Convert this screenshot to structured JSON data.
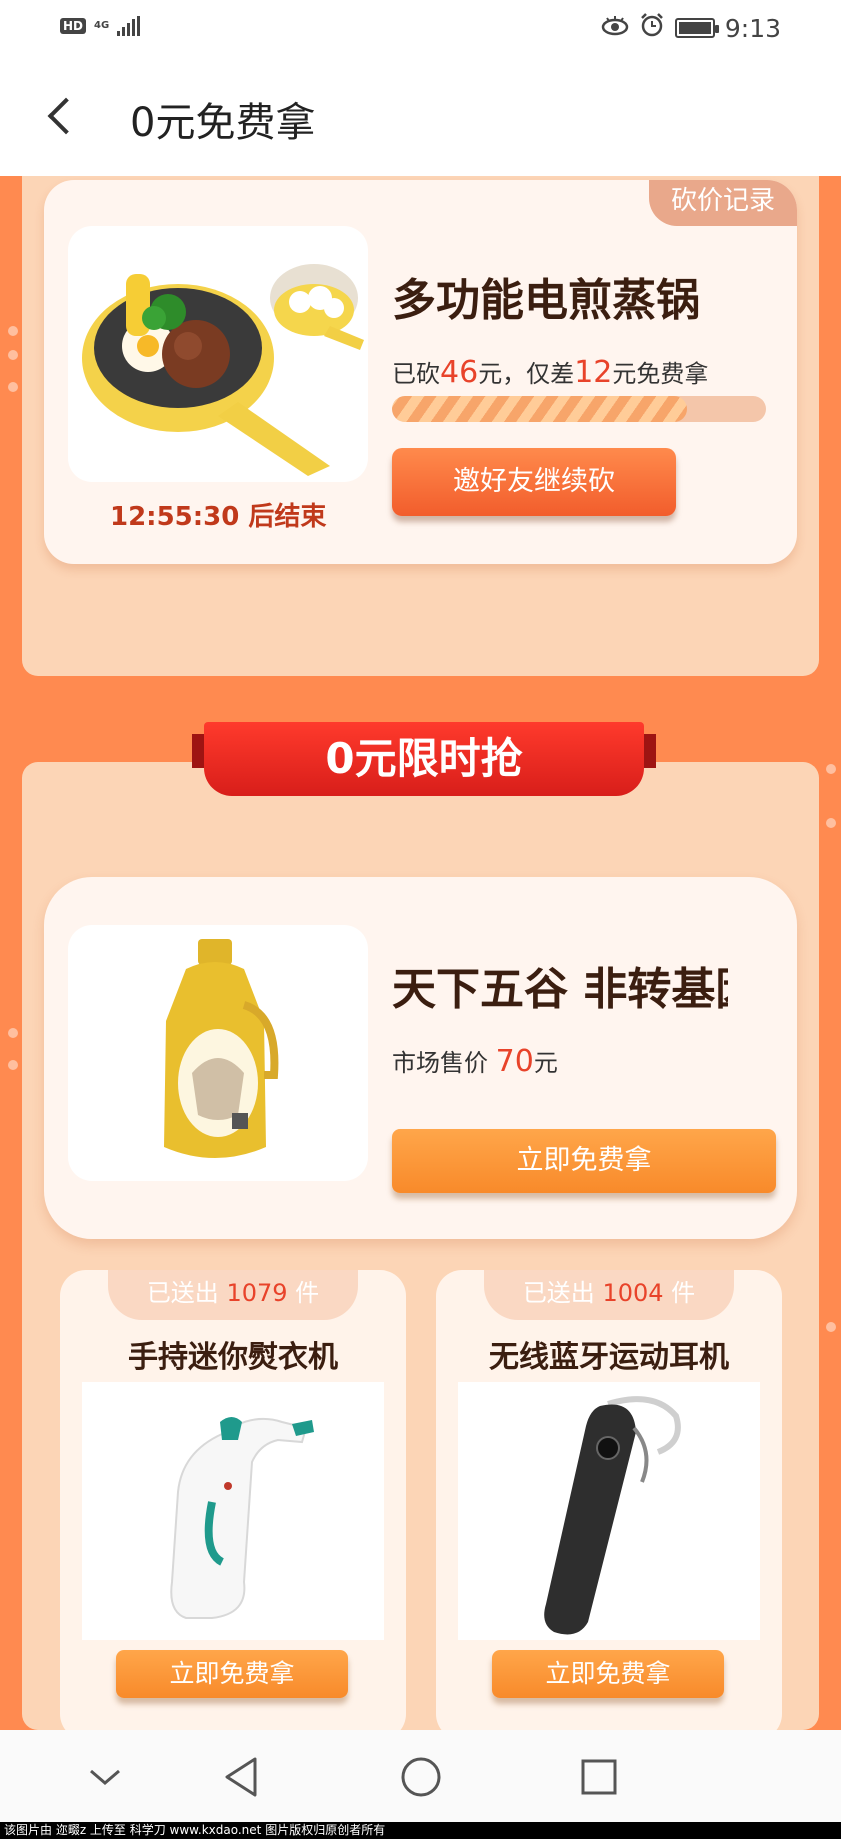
{
  "status_bar": {
    "hd": "HD",
    "network": "4G",
    "time": "9:13"
  },
  "header": {
    "title": "0元免费拿"
  },
  "bargain": {
    "record_tab": "砍价记录",
    "title": "多功能电煎蒸锅",
    "info_prefix": "已砍",
    "cut_amount": "46",
    "info_mid": "元，仅差",
    "remain_amount": "12",
    "info_suffix": "元免费拿",
    "progress": 0.79,
    "button": "邀好友继续砍",
    "countdown": "12:55:30 后结束"
  },
  "section": {
    "ribbon": "0元限时抢"
  },
  "main_product": {
    "title": "天下五谷 非转基因",
    "price_label": "市场售价",
    "price": "70",
    "price_unit": "元",
    "button": "立即免费拿"
  },
  "small_products": [
    {
      "sent_prefix": "已送出",
      "sent_count": "1079",
      "sent_unit": "件",
      "title": "手持迷你熨衣机",
      "button": "立即免费拿"
    },
    {
      "sent_prefix": "已送出",
      "sent_count": "1004",
      "sent_unit": "件",
      "title": "无线蓝牙运动耳机",
      "button": "立即免费拿"
    }
  ],
  "watermark": "该图片由 迩畷z 上传至 科学刀 www.kxdao.net 图片版权归原创者所有",
  "colors": {
    "page_bg": "#ff8a50",
    "accent_red": "#e8432a",
    "button_orange": "#f88a2a",
    "ribbon_red": "#d81e1a"
  },
  "icons": [
    "back-icon",
    "eye-icon",
    "alarm-icon",
    "battery-icon",
    "nav-down-icon",
    "nav-back-icon",
    "nav-home-icon",
    "nav-recent-icon"
  ]
}
